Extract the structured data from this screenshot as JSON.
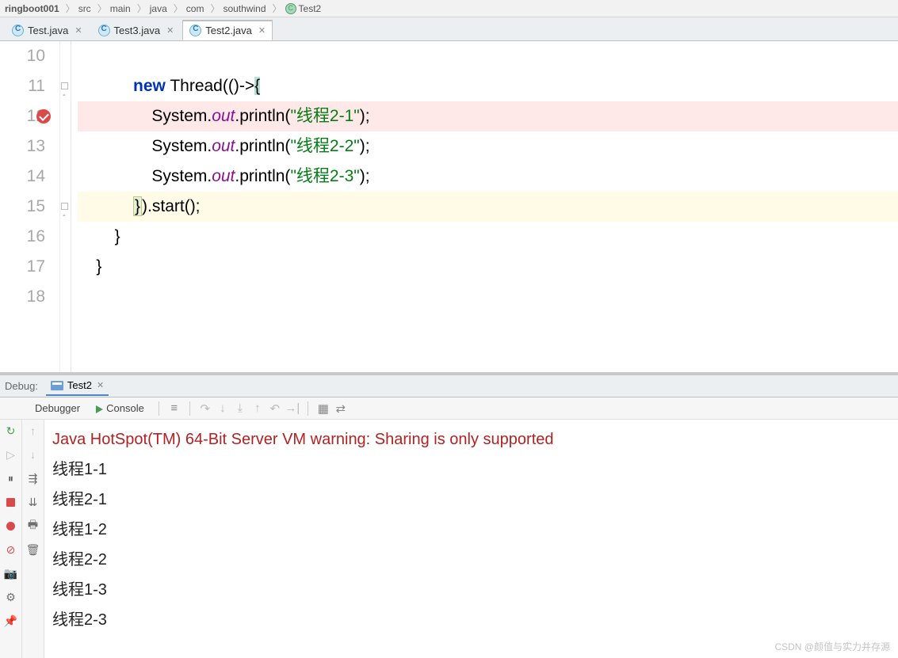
{
  "breadcrumb": {
    "parts": [
      "ringboot001",
      "src",
      "main",
      "java",
      "com",
      "southwind",
      "Test2"
    ]
  },
  "tabs": [
    {
      "label": "Test.java",
      "active": false
    },
    {
      "label": "Test3.java",
      "active": false
    },
    {
      "label": "Test2.java",
      "active": true
    }
  ],
  "editor": {
    "lines": [
      {
        "n": 10,
        "html": ""
      },
      {
        "n": 11,
        "html": "            <span class='kw'>new</span> Thread(()-&gt;<span class='caret-bg'>{</span>"
      },
      {
        "n": 12,
        "html": "                System.<span class='static'>out</span>.println(<span class='str'>\"线程2-1\"</span>);",
        "cls": "hl-pink",
        "bp": true
      },
      {
        "n": 13,
        "html": "                System.<span class='static'>out</span>.println(<span class='str'>\"线程2-2\"</span>);"
      },
      {
        "n": 14,
        "html": "                System.<span class='static'>out</span>.println(<span class='str'>\"线程2-3\"</span>);"
      },
      {
        "n": 15,
        "html": "            <span class='brace-hl'>}</span>).start();",
        "cls": "hl-yellow"
      },
      {
        "n": 16,
        "html": "        }"
      },
      {
        "n": 17,
        "html": "    }"
      },
      {
        "n": 18,
        "html": ""
      }
    ]
  },
  "debug": {
    "title": "Debug:",
    "tab": "Test2",
    "subtabs": {
      "debugger": "Debugger",
      "console": "Console"
    }
  },
  "console": {
    "err": "Java HotSpot(TM) 64-Bit Server VM warning: Sharing is only supported",
    "lines": [
      "线程1-1",
      "线程2-1",
      "线程1-2",
      "线程2-2",
      "线程1-3",
      "线程2-3"
    ]
  },
  "watermark": "CSDN @颜值与实力并存源"
}
